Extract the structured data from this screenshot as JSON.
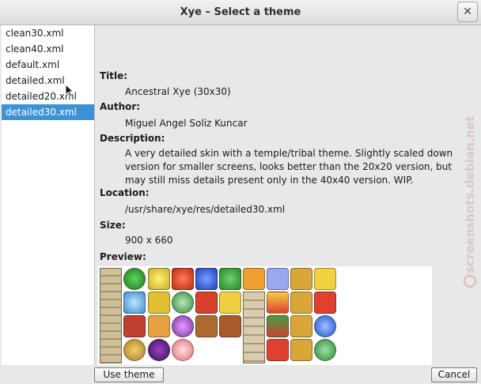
{
  "window": {
    "title": "Xye – Select a theme"
  },
  "themes": [
    "clean30.xml",
    "clean40.xml",
    "default.xml",
    "detailed.xml",
    "detailed20.xml",
    "detailed30.xml"
  ],
  "selected_index": 5,
  "details": {
    "title_label": "Title:",
    "title_value": "Ancestral Xye (30x30)",
    "author_label": "Author:",
    "author_value": "Miguel Angel Soliz Kuncar",
    "description_label": "Description:",
    "description_value": " A very detailed skin with a temple/tribal theme. Slightly scaled down version for smaller screens, looks better than the 20x20 version, but may still miss details present only in the 40x40 version. WIP.",
    "location_label": "Location:",
    "location_value": "/usr/share/xye/res/detailed30.xml",
    "size_label": "Size:",
    "size_value": " 900 x 660",
    "preview_label": "Preview:"
  },
  "buttons": {
    "use_theme": "Use theme",
    "cancel": "Cancel"
  },
  "watermark": "screenshots.debian.net",
  "colors": {
    "selection": "#3d92d6",
    "green": "#2fa02f",
    "yellow": "#e8d83a",
    "red": "#e0442a",
    "blue": "#3f6be0",
    "gold": "#d9a63a"
  }
}
